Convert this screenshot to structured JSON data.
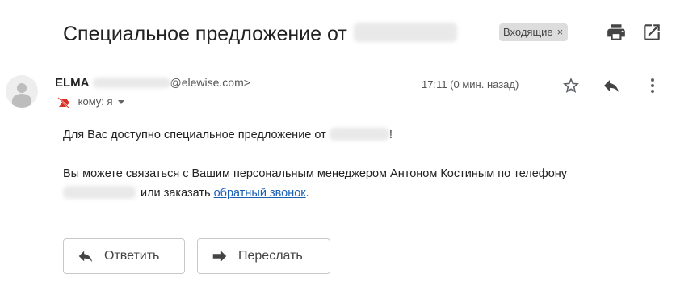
{
  "email": {
    "subject": "Специальное предложение от",
    "label": "Входящие",
    "label_close": "×",
    "sender_name": "ELMA",
    "sender_domain": "@elewise.com>",
    "recipient_line": "кому: я",
    "timestamp": "17:11 (0 мин. назад)",
    "body_line1": "Для Вас доступно специальное предложение от",
    "body_line1_end": "!",
    "body_line2": "Вы можете связаться с Вашим персональным менеджером Антоном Костиным по телефону",
    "body_line3_text": "или заказать",
    "body_link": "обратный звонок",
    "body_line3_end": "."
  },
  "actions": {
    "reply_label": "Ответить",
    "forward_label": "Переслать"
  },
  "icons": {
    "print": "print-icon",
    "popout": "open-in-new-window-icon",
    "avatar": "person-icon",
    "not_important": "label-not-important-icon",
    "star": "star-icon",
    "reply": "reply-icon",
    "more": "more-vertical-icon",
    "forward": "forward-icon"
  },
  "colors": {
    "link": "#1a5fb4",
    "label_chip_bg": "#dddddd",
    "important_marker": "#d93025",
    "icon_gray": "#5f6368"
  }
}
